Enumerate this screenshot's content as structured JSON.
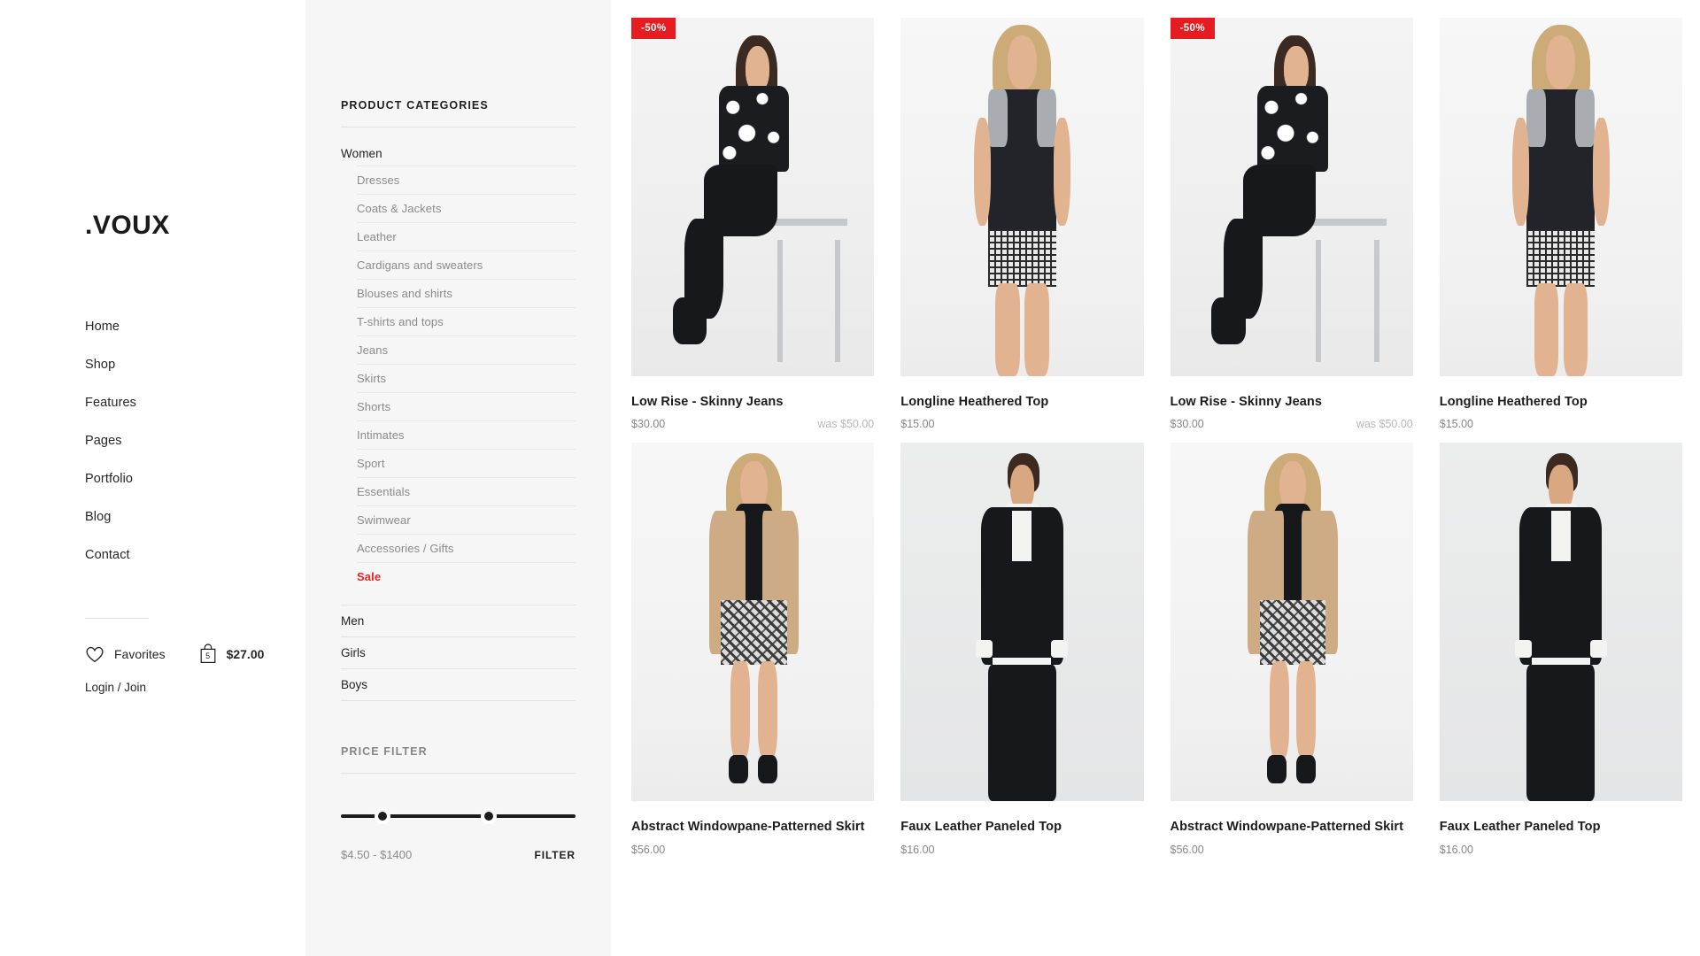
{
  "brand": {
    "logo": ".VOUX"
  },
  "nav": {
    "items": [
      {
        "label": "Home"
      },
      {
        "label": "Shop"
      },
      {
        "label": "Features"
      },
      {
        "label": "Pages"
      },
      {
        "label": "Portfolio"
      },
      {
        "label": "Blog"
      },
      {
        "label": "Contact"
      }
    ]
  },
  "utility": {
    "favorites_label": "Favorites",
    "favorites_icon": "heart-icon",
    "cart_icon": "shopping-bag-icon",
    "cart_count": "5",
    "cart_total": "$27.00",
    "account_label": "Login / Join"
  },
  "sidebar": {
    "categories_title": "PRODUCT CATEGORIES",
    "women_label": "Women",
    "women_subcategories": [
      {
        "label": "Dresses",
        "sale": false
      },
      {
        "label": "Coats & Jackets",
        "sale": false
      },
      {
        "label": "Leather",
        "sale": false
      },
      {
        "label": "Cardigans and sweaters",
        "sale": false
      },
      {
        "label": "Blouses and shirts",
        "sale": false
      },
      {
        "label": "T-shirts and tops",
        "sale": false
      },
      {
        "label": "Jeans",
        "sale": false
      },
      {
        "label": "Skirts",
        "sale": false
      },
      {
        "label": "Shorts",
        "sale": false
      },
      {
        "label": "Intimates",
        "sale": false
      },
      {
        "label": "Sport",
        "sale": false
      },
      {
        "label": "Essentials",
        "sale": false
      },
      {
        "label": "Swimwear",
        "sale": false
      },
      {
        "label": "Accessories / Gifts",
        "sale": false
      },
      {
        "label": "Sale",
        "sale": true
      }
    ],
    "other_categories": [
      {
        "label": "Men"
      },
      {
        "label": "Girls"
      },
      {
        "label": "Boys"
      }
    ],
    "price_filter_title": "PRICE FILTER",
    "price_range_label": "$4.50 - $1400",
    "filter_button_label": "FILTER",
    "price_min": "$4.50",
    "price_max": "$1400"
  },
  "colors": {
    "sale_red": "#e51c22",
    "sidebar_bg": "#f6f6f6",
    "text_primary": "#1c1c1c",
    "text_muted": "#868686"
  },
  "products": [
    {
      "name": "Low Rise - Skinny Jeans",
      "price": "$30.00",
      "old_price": "was $50.00",
      "badge": "-50%",
      "image_alt": "woman-in-floral-top-and-black-jeans-on-stool"
    },
    {
      "name": "Longline Heathered Top",
      "price": "$15.00",
      "old_price": "",
      "badge": "",
      "image_alt": "woman-in-black-tank-top-and-gray-shorts"
    },
    {
      "name": "Low Rise - Skinny Jeans",
      "price": "$30.00",
      "old_price": "was $50.00",
      "badge": "-50%",
      "image_alt": "woman-in-floral-top-and-black-jeans-on-stool"
    },
    {
      "name": "Longline Heathered Top",
      "price": "$15.00",
      "old_price": "",
      "badge": "",
      "image_alt": "woman-in-black-tank-top-and-gray-shorts"
    },
    {
      "name": "Abstract Windowpane-Patterned Skirt",
      "price": "$56.00",
      "old_price": "",
      "badge": "",
      "image_alt": "woman-in-camel-coat-and-patterned-skirt"
    },
    {
      "name": "Faux Leather Paneled Top",
      "price": "$16.00",
      "old_price": "",
      "badge": "",
      "image_alt": "man-in-black-sweater-and-white-shirt"
    },
    {
      "name": "Abstract Windowpane-Patterned Skirt",
      "price": "$56.00",
      "old_price": "",
      "badge": "",
      "image_alt": "woman-in-camel-coat-and-patterned-skirt"
    },
    {
      "name": "Faux Leather Paneled Top",
      "price": "$16.00",
      "old_price": "",
      "badge": "",
      "image_alt": "man-in-black-sweater-and-white-shirt"
    }
  ]
}
